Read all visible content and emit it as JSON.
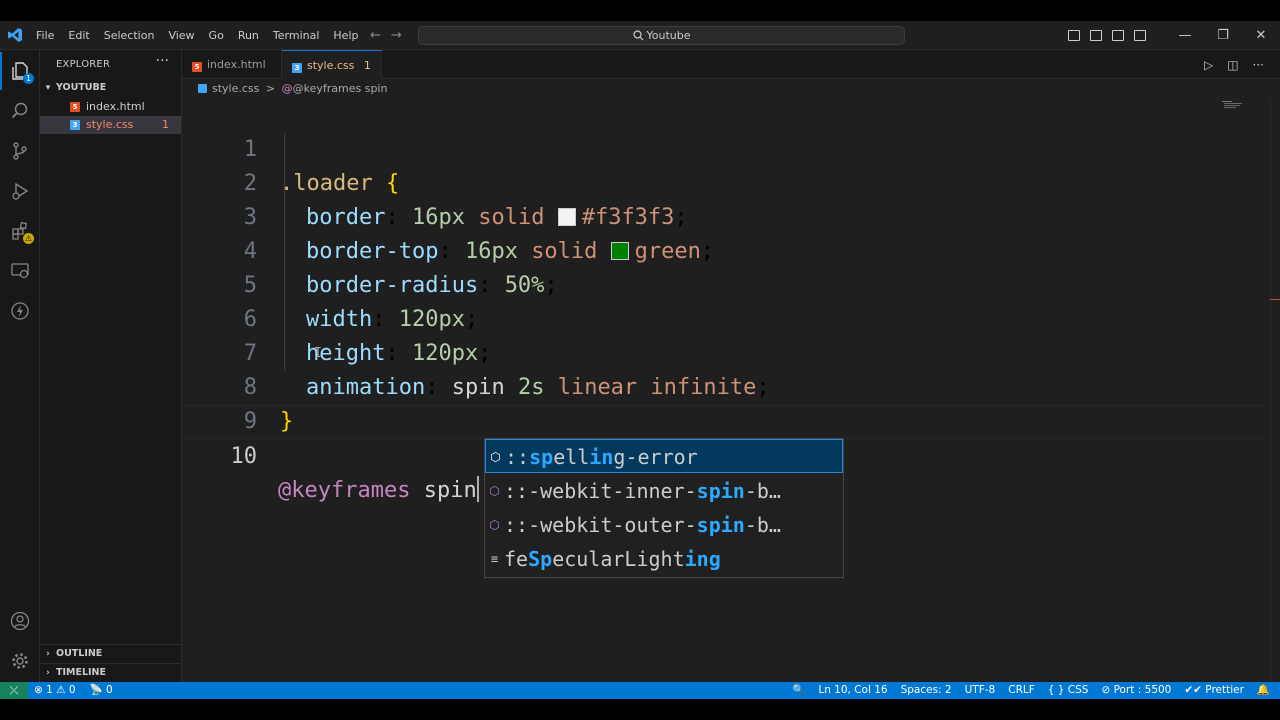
{
  "window": {
    "search_text": "Youtube",
    "menu": [
      "File",
      "Edit",
      "Selection",
      "View",
      "Go",
      "Run",
      "Terminal",
      "Help"
    ]
  },
  "activity_bar": {
    "explorer_badge": "1",
    "extensions_badge": "⚠"
  },
  "sidebar": {
    "title": "EXPLORER",
    "more": "···",
    "folder": "YOUTUBE",
    "files": [
      {
        "name": "index.html",
        "count": ""
      },
      {
        "name": "style.css",
        "count": "1"
      }
    ],
    "outline": "OUTLINE",
    "timeline": "TIMELINE"
  },
  "tabs": [
    {
      "name": "index.html",
      "count": "",
      "dirty": ""
    },
    {
      "name": "style.css",
      "count": "1",
      "dirty": "●"
    }
  ],
  "breadcrumb": {
    "file": "style.css",
    "separator": ">",
    "symbol": "@keyframes spin"
  },
  "editor": {
    "line_numbers": [
      "1",
      "2",
      "3",
      "4",
      "5",
      "6",
      "7",
      "8",
      "9",
      "10"
    ],
    "code": {
      "l1_sel": ".loader",
      "l1_brace": "{",
      "l2_prop": "border",
      "l2_num": "16px",
      "l2_kw": "solid",
      "l2_color": "#f3f3f3",
      "l3_prop": "border-top",
      "l3_num": "16px",
      "l3_kw": "solid",
      "l3_color": "green",
      "l4_prop": "border-radius",
      "l4_num": "50%",
      "l5_prop": "width",
      "l5_num": "120px",
      "l6_prop": "height",
      "l6_num": "120px",
      "l7_prop": "animation",
      "l7_name": "spin",
      "l7_num": "2s",
      "l7_kw": "linear infinite",
      "l8_brace": "}",
      "l10_at": "@keyframes",
      "l10_id": "spin"
    },
    "swatches": [
      "#f3f3f3",
      "#008000"
    ]
  },
  "suggestions": [
    {
      "icon": "⬡",
      "parts": [
        [
          "::",
          false
        ],
        [
          "sp",
          true
        ],
        [
          "ell",
          false
        ],
        [
          "in",
          true
        ],
        [
          "g-error",
          false
        ]
      ]
    },
    {
      "icon": "⬡",
      "parts": [
        [
          "::-webkit-inner-",
          false
        ],
        [
          "spin",
          true
        ],
        [
          "-b…",
          false
        ]
      ]
    },
    {
      "icon": "⬡",
      "parts": [
        [
          "::-webkit-outer-",
          false
        ],
        [
          "spin",
          true
        ],
        [
          "-b…",
          false
        ]
      ]
    },
    {
      "icon": "≡",
      "parts": [
        [
          "fe",
          false
        ],
        [
          "Sp",
          true
        ],
        [
          "ecularLight",
          false
        ],
        [
          "ing",
          true
        ]
      ]
    }
  ],
  "status": {
    "remote": "⤫",
    "errors": "⊗ 1",
    "warnings": "⚠ 0",
    "ports": "📡 0",
    "zoom": "🔍",
    "position": "Ln 10, Col 16",
    "spaces": "Spaces: 2",
    "encoding": "UTF-8",
    "eol": "CRLF",
    "language": "{ } CSS",
    "port": "⊘ Port : 5500",
    "prettier": "✔✔ Prettier",
    "bell": "🔔"
  },
  "colors": {
    "accent": "#0078d4",
    "editor_bg": "#1f1f1f",
    "sidebar_bg": "#181818",
    "statusbar": "#0078d4"
  }
}
